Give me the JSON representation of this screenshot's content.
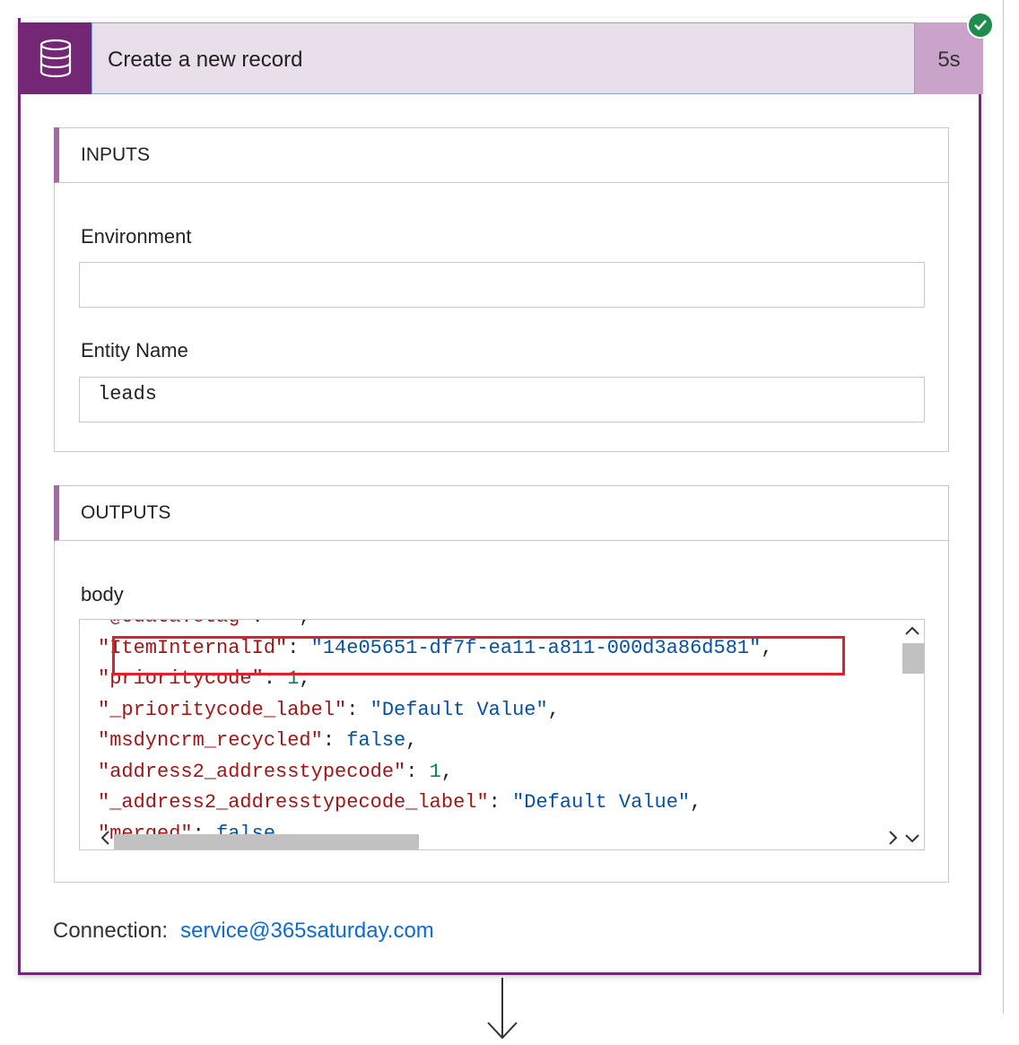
{
  "action": {
    "title": "Create a new record",
    "duration": "5s",
    "icon": "database-icon",
    "status_icon": "success-check-icon",
    "accent_color": "#742774"
  },
  "inputs": {
    "heading": "INPUTS",
    "environment_label": "Environment",
    "environment_value": "",
    "entity_label": "Entity Name",
    "entity_value": "leads"
  },
  "outputs": {
    "heading": "OUTPUTS",
    "body_label": "body",
    "lines": [
      {
        "key": "\"@odata.etag\"",
        "sep": ": ",
        "value": "\"\"",
        "vtype": "s",
        "end": ","
      },
      {
        "key": "\"ItemInternalId\"",
        "sep": ": ",
        "value": "\"14e05651-df7f-ea11-a811-000d3a86d581\"",
        "vtype": "s",
        "end": ","
      },
      {
        "key": "\"prioritycode\"",
        "sep": ": ",
        "value": "1",
        "vtype": "n",
        "end": ","
      },
      {
        "key": "\"_prioritycode_label\"",
        "sep": ": ",
        "value": "\"Default Value\"",
        "vtype": "s",
        "end": ","
      },
      {
        "key": "\"msdyncrm_recycled\"",
        "sep": ": ",
        "value": "false",
        "vtype": "s",
        "end": ","
      },
      {
        "key": "\"address2_addresstypecode\"",
        "sep": ": ",
        "value": "1",
        "vtype": "n",
        "end": ","
      },
      {
        "key": "\"_address2_addresstypecode_label\"",
        "sep": ": ",
        "value": "\"Default Value\"",
        "vtype": "s",
        "end": ","
      },
      {
        "key": "\"merged\"",
        "sep": ": ",
        "value": "false",
        "vtype": "s",
        "end": ","
      }
    ]
  },
  "connection": {
    "label": "Connection:",
    "value": "service@365saturday.com"
  }
}
